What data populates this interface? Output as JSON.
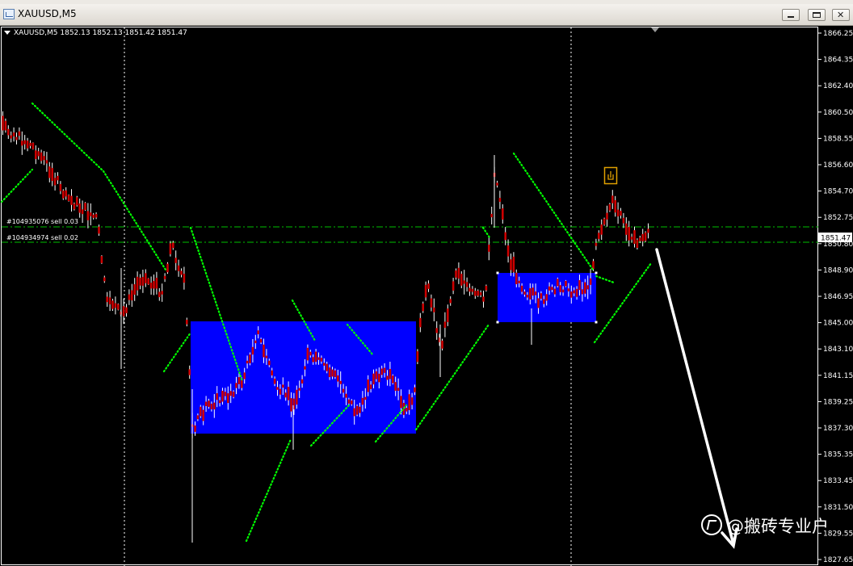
{
  "window": {
    "title": "XAUUSD,M5",
    "minimize_icon": "minimize-icon",
    "maximize_icon": "restore-icon",
    "close_icon": "close-icon",
    "close_glyph": "✕"
  },
  "chart": {
    "symbol_info": "XAUUSD,M5",
    "ohlc": "1852.13 1852.13 1851.42 1851.47",
    "current_price": "1851.47",
    "price_ticks": [
      "1866.25",
      "1864.35",
      "1862.40",
      "1860.50",
      "1858.55",
      "1856.60",
      "1854.70",
      "1852.75",
      "1850.80",
      "1848.90",
      "1846.95",
      "1845.00",
      "1843.10",
      "1841.15",
      "1839.25",
      "1837.30",
      "1835.35",
      "1833.45",
      "1831.50",
      "1829.55",
      "1827.65"
    ],
    "orders": [
      {
        "label": "#104935076 sell 0.03"
      },
      {
        "label": "#104934974 sell 0.02"
      }
    ],
    "colors": {
      "background": "#000000",
      "candle": "#cc0000",
      "wick": "#ffffff",
      "box": "#0000ff",
      "trend_dots": "#00ff00",
      "order_line": "#00c000",
      "arrow": "#ffffff",
      "price_label_bg": "#ffffff"
    },
    "signal_icon": "hand-pointer-icon"
  },
  "watermark": {
    "text": "@搬砖专业户",
    "logo_icon": "zhihu-logo-icon"
  }
}
